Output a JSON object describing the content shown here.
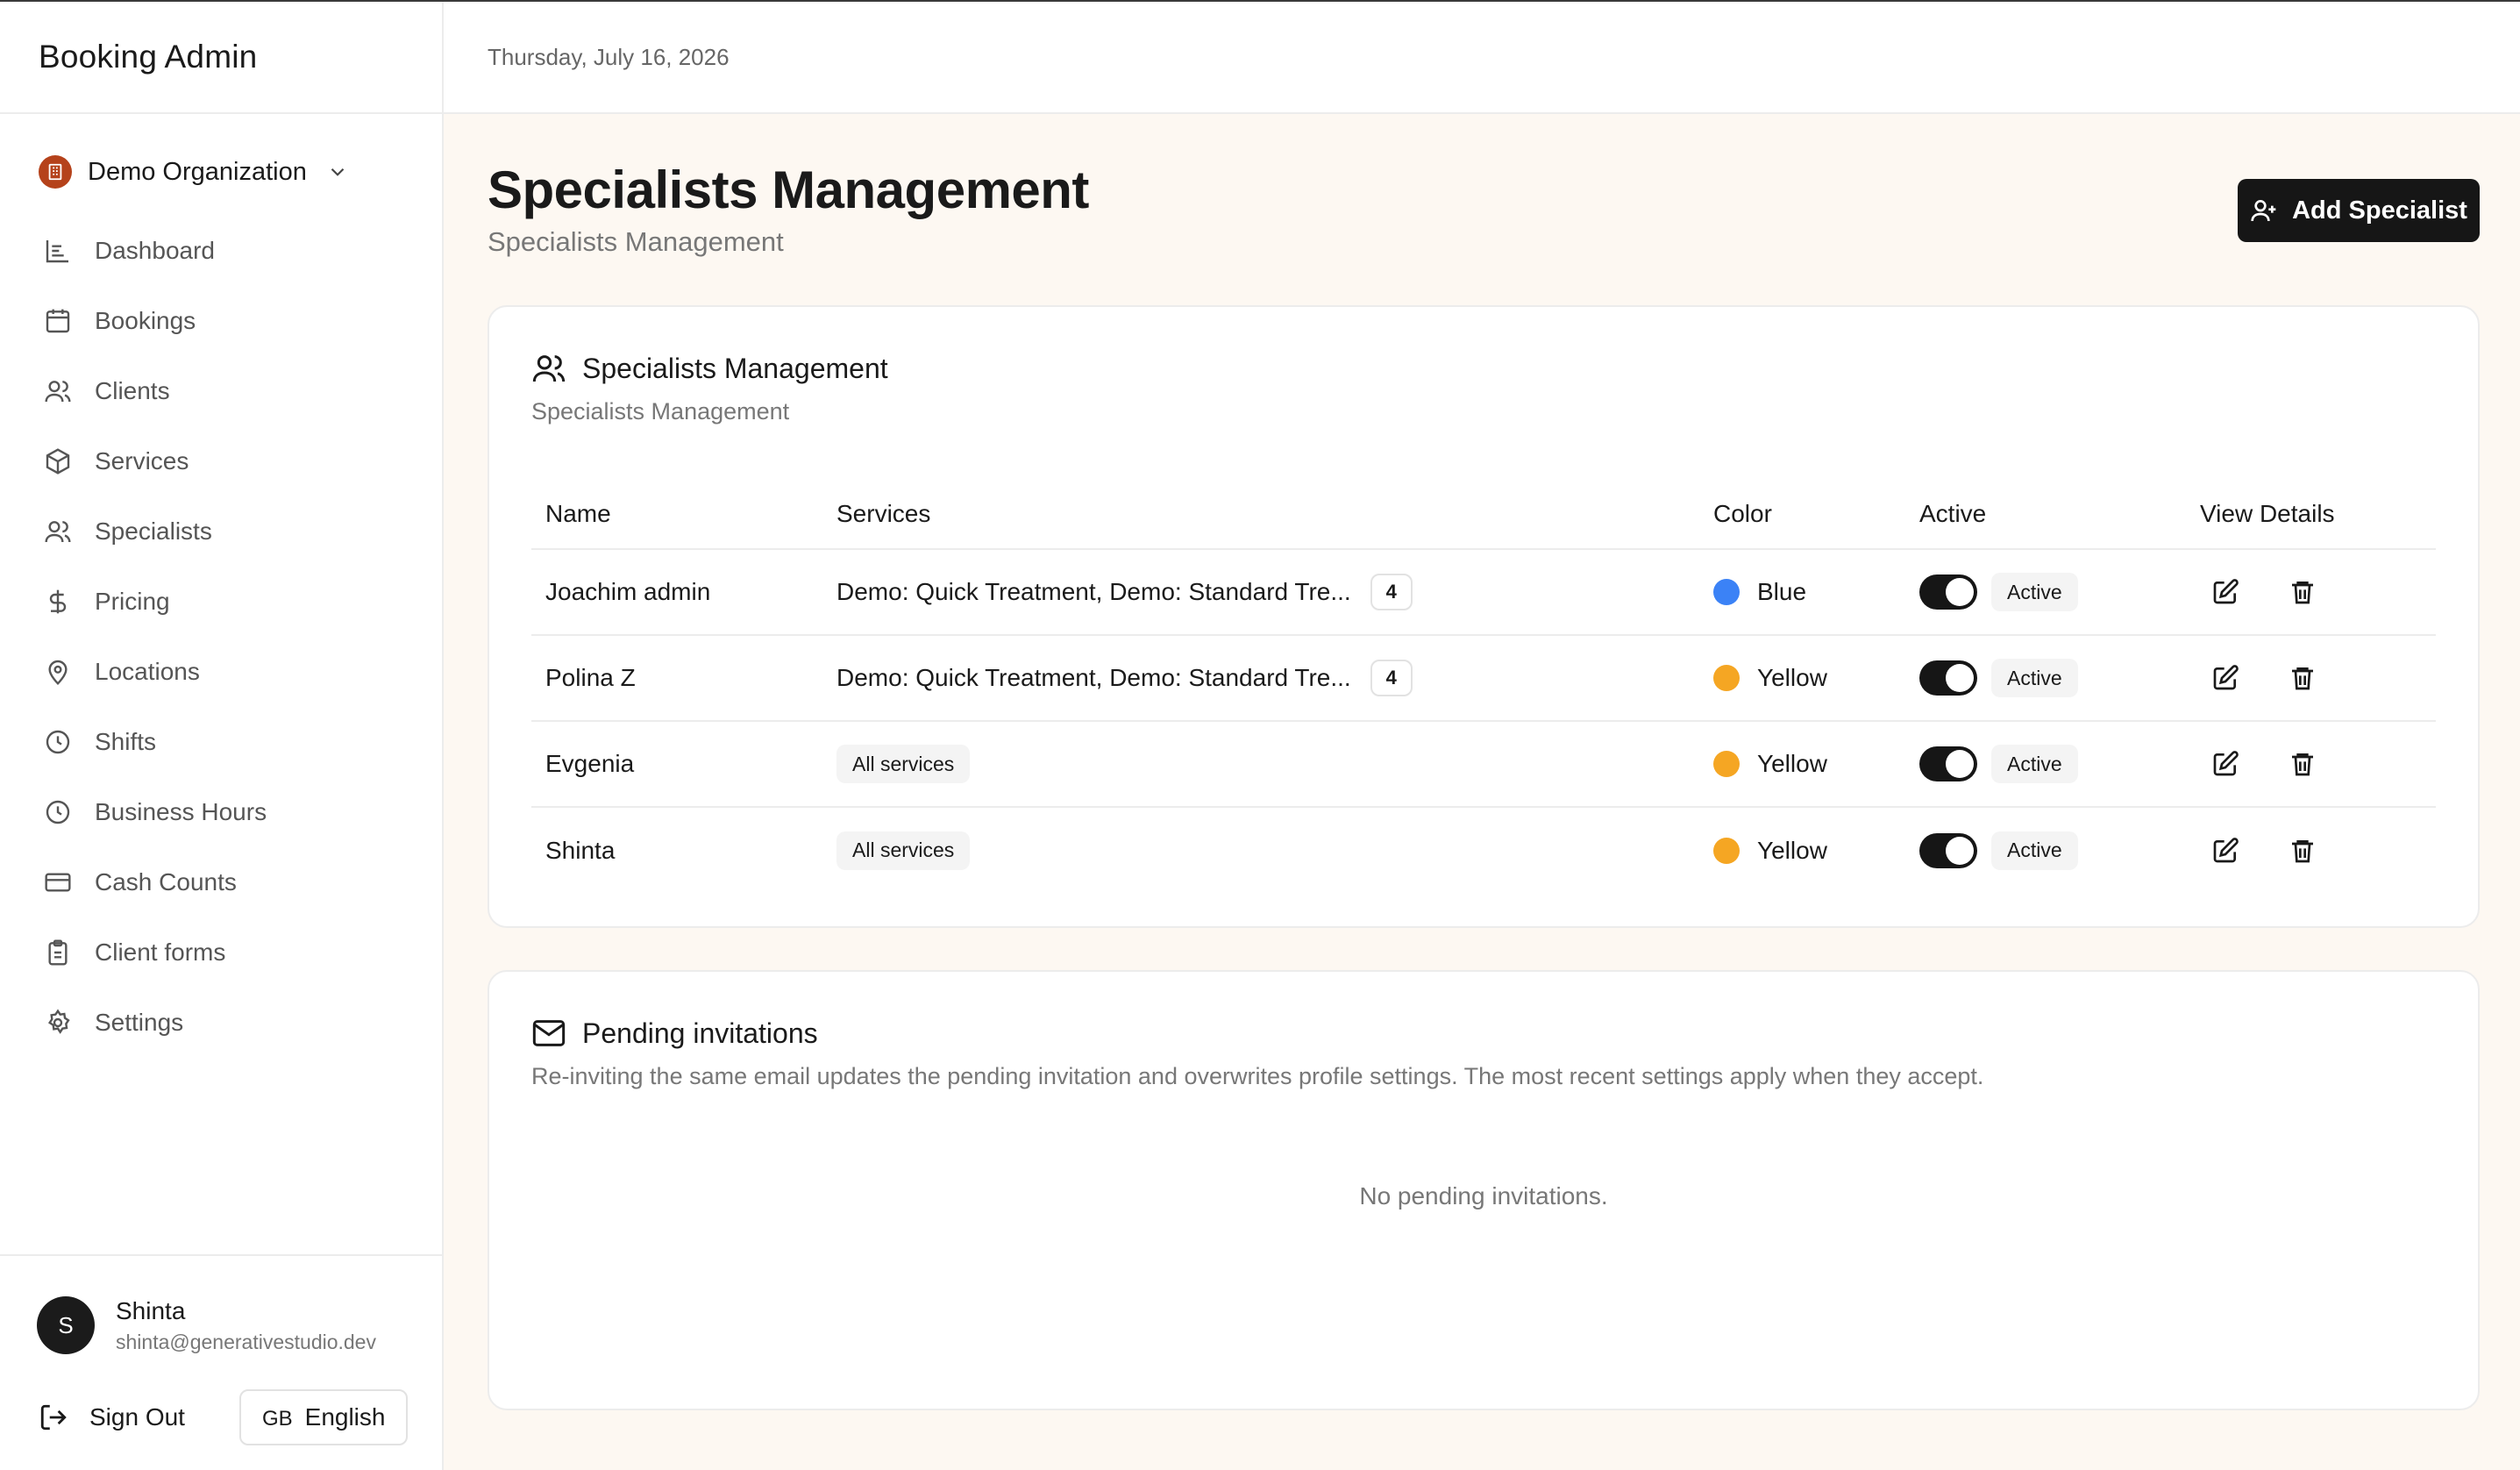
{
  "app": {
    "title": "Booking Admin"
  },
  "org": {
    "name": "Demo Organization"
  },
  "nav": [
    {
      "label": "Dashboard",
      "icon": "dashboard-icon"
    },
    {
      "label": "Bookings",
      "icon": "calendar-icon"
    },
    {
      "label": "Clients",
      "icon": "users-icon"
    },
    {
      "label": "Services",
      "icon": "package-icon"
    },
    {
      "label": "Specialists",
      "icon": "users-icon"
    },
    {
      "label": "Pricing",
      "icon": "dollar-icon"
    },
    {
      "label": "Locations",
      "icon": "map-pin-icon"
    },
    {
      "label": "Shifts",
      "icon": "clock-icon"
    },
    {
      "label": "Business Hours",
      "icon": "clock-icon"
    },
    {
      "label": "Cash Counts",
      "icon": "credit-card-icon"
    },
    {
      "label": "Client forms",
      "icon": "clipboard-icon"
    },
    {
      "label": "Settings",
      "icon": "gear-icon"
    }
  ],
  "user": {
    "initial": "S",
    "name": "Shinta",
    "email": "shinta@generativestudio.dev"
  },
  "footer": {
    "sign_out": "Sign Out",
    "lang_code": "GB",
    "lang_label": "English"
  },
  "topbar": {
    "date": "Thursday, July 16, 2026"
  },
  "page": {
    "title": "Specialists Management",
    "subtitle": "Specialists Management",
    "add_button": "Add Specialist"
  },
  "specialists_card": {
    "title": "Specialists Management",
    "description": "Specialists Management",
    "columns": [
      "Name",
      "Services",
      "Color",
      "Active",
      "View Details"
    ],
    "rows": [
      {
        "name": "Joachim admin",
        "services": "Demo: Quick Treatment, Demo: Standard Tre...",
        "services_count": "4",
        "color_name": "Blue",
        "color_hex": "#3b82f6",
        "status": "Active"
      },
      {
        "name": "Polina Z",
        "services": "Demo: Quick Treatment, Demo: Standard Tre...",
        "services_count": "4",
        "color_name": "Yellow",
        "color_hex": "#f5a623",
        "status": "Active"
      },
      {
        "name": "Evgenia",
        "services": "All services",
        "services_count": "",
        "color_name": "Yellow",
        "color_hex": "#f5a623",
        "status": "Active"
      },
      {
        "name": "Shinta",
        "services": "All services",
        "services_count": "",
        "color_name": "Yellow",
        "color_hex": "#f5a623",
        "status": "Active"
      }
    ]
  },
  "invites_card": {
    "title": "Pending invitations",
    "description": "Re-inviting the same email updates the pending invitation and overwrites profile settings. The most recent settings apply when they accept.",
    "empty": "No pending invitations."
  },
  "colors": {
    "accent": "#161616",
    "background": "#fdf8f2",
    "org_logo": "#b5421b"
  }
}
